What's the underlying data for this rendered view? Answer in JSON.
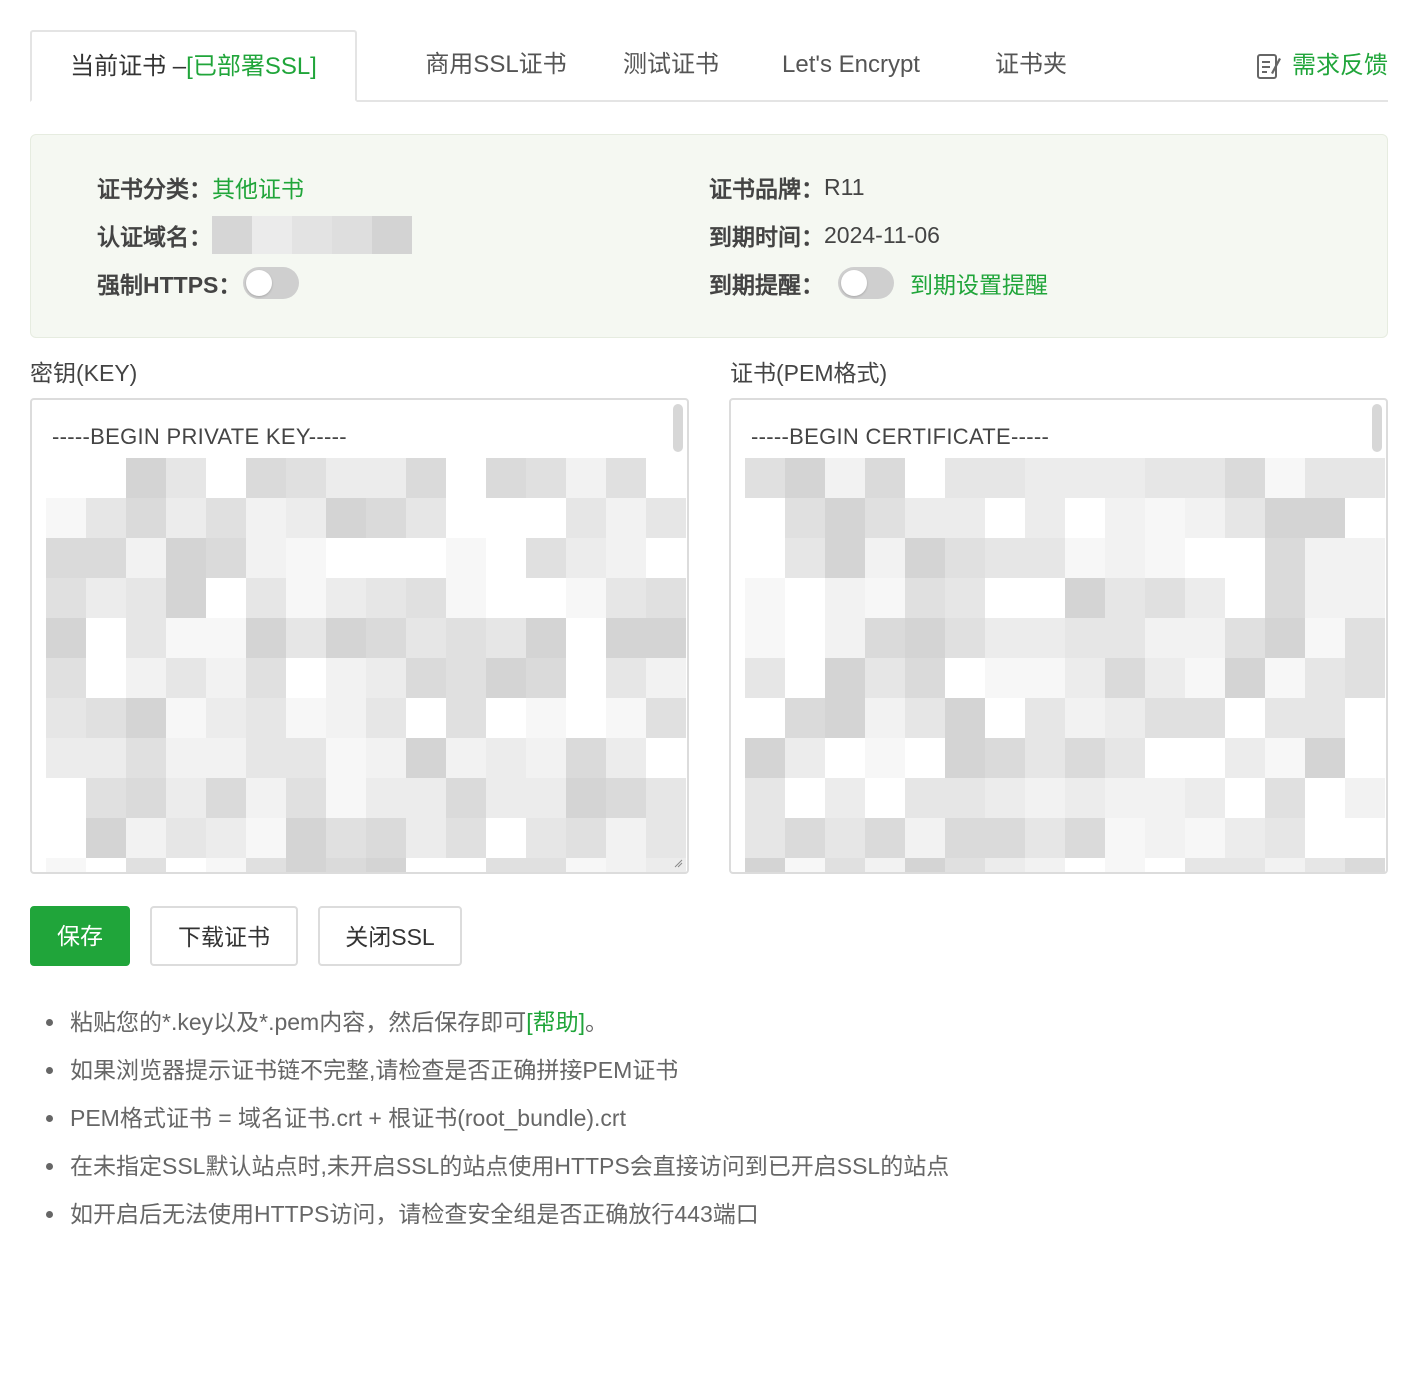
{
  "tabs": {
    "current": {
      "label": "当前证书 –",
      "status": "[已部署SSL]"
    },
    "items": [
      "商用SSL证书",
      "测试证书",
      "Let's Encrypt",
      "证书夹"
    ],
    "feedback_label": "需求反馈"
  },
  "info": {
    "category_label": "证书分类：",
    "category_value": "其他证书",
    "brand_label": "证书品牌：",
    "brand_value": "R11",
    "domain_label": "认证域名：",
    "expiry_label": "到期时间：",
    "expiry_value": "2024-11-06",
    "force_https_label": "强制HTTPS：",
    "expiry_reminder_label": "到期提醒：",
    "expiry_reminder_link": "到期设置提醒"
  },
  "editors": {
    "key_label": "密钥(KEY)",
    "key_first_line": "-----BEGIN PRIVATE KEY-----",
    "pem_label": "证书(PEM格式)",
    "pem_first_line": "-----BEGIN CERTIFICATE-----"
  },
  "buttons": {
    "save": "保存",
    "download": "下载证书",
    "close_ssl": "关闭SSL"
  },
  "tips": {
    "tip1_pre": "粘贴您的*.key以及*.pem内容，然后保存即可",
    "tip1_link": "[帮助]",
    "tip1_post": "。",
    "tip2": "如果浏览器提示证书链不完整,请检查是否正确拼接PEM证书",
    "tip3": "PEM格式证书 = 域名证书.crt + 根证书(root_bundle).crt",
    "tip4": "在未指定SSL默认站点时,未开启SSL的站点使用HTTPS会直接访问到已开启SSL的站点",
    "tip5": "如开启后无法使用HTTPS访问，请检查安全组是否正确放行443端口"
  },
  "colors": {
    "accent": "#20a53a",
    "panel_bg": "#f5f8f2",
    "toggle_off": "#cfcfcf"
  }
}
